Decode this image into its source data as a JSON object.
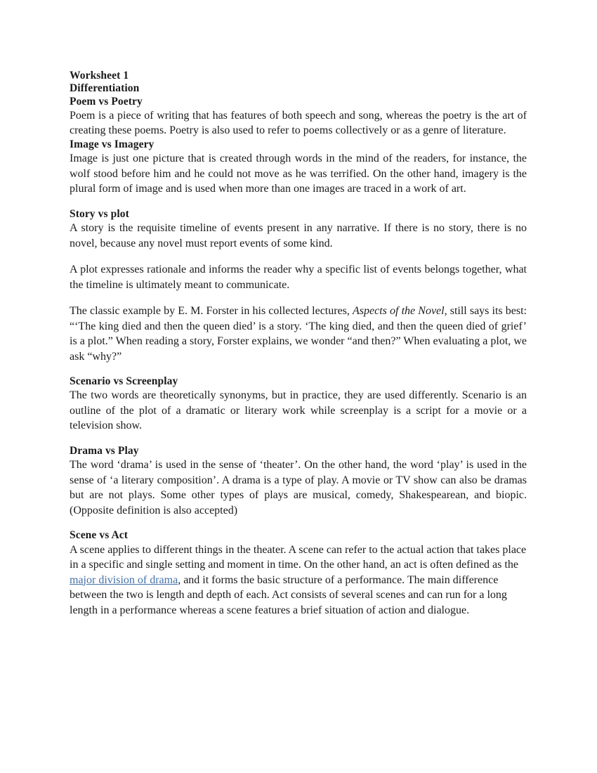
{
  "document": {
    "title": "Worksheet 1",
    "subtitle": "Differentiation",
    "link_color": "#4472a8",
    "text_color": "#1a1a1a",
    "background_color": "#ffffff"
  },
  "sections": [
    {
      "heading": "Poem vs Poetry",
      "paragraphs": [
        "Poem is a piece of writing that has features of both speech and song, whereas the poetry is the art of creating these poems. Poetry is also used to refer to poems collectively or as a genre of literature."
      ]
    },
    {
      "heading": "Image vs Imagery",
      "paragraphs": [
        "Image is just one picture that is created through words in the mind of the readers, for instance, the wolf stood before him and he could not move as he was terrified. On the other hand, imagery is the plural form of image and is used when more than one images are traced in a work of art."
      ]
    },
    {
      "heading": "Story vs plot",
      "paragraphs": [
        "A story is the requisite timeline of events present in any narrative. If there is no story, there is no novel, because any novel must report events of some kind.",
        "A plot expresses rationale and informs the reader why a specific list of events belongs together, what the timeline is ultimately meant to communicate."
      ],
      "forster_paragraph": {
        "before_title": "The classic example by E. M. Forster in his collected lectures, ",
        "italic_title": "Aspects of the Novel",
        "after_title": ", still says its best: “‘The king died and then the queen died’ is a story. ‘The king died, and then the queen died of grief’ is a plot.” When reading a story, Forster explains, we wonder “and then?” When evaluating a plot, we ask “why?”"
      }
    },
    {
      "heading": "Scenario vs Screenplay",
      "paragraphs": [
        "The two words are theoretically synonyms, but in practice, they are used differently. Scenario is an outline of the plot of a dramatic or literary work while screenplay is a script for a movie or a television show."
      ]
    },
    {
      "heading": "Drama vs Play",
      "paragraphs": [
        "The word ‘drama’ is used in the sense of ‘theater’. On the other hand, the word ‘play’ is used in the sense of ‘a literary composition’. A drama is a type of play. A movie or TV show can also be dramas but are not plays. Some other types of plays are musical, comedy, Shakespearean, and biopic. (Opposite definition is also accepted)"
      ]
    },
    {
      "heading": "Scene vs Act",
      "scene_paragraph": {
        "before_link": "A scene applies to different things in the theater. A scene can refer to the actual action that takes place in a specific and single setting and moment in time. On the other hand, an act is often defined as the ",
        "link_text": "major division of drama",
        "after_link": ", and it forms the basic structure of a performance. The main difference between the two is length and depth of each. Act consists of several scenes and can run for a long length in a performance whereas a scene features a brief situation of action and dialogue."
      }
    }
  ]
}
